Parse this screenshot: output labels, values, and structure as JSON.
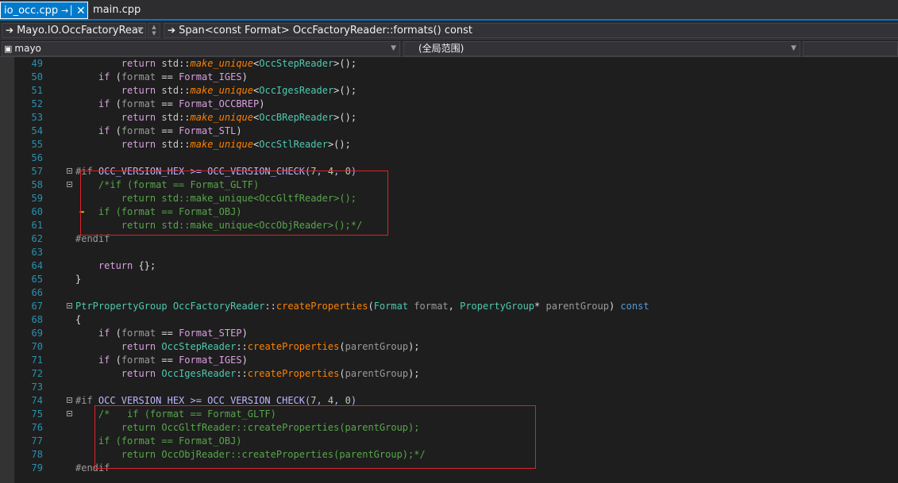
{
  "tabs": [
    {
      "label": "io_occ.cpp",
      "active": true,
      "pin_icon": "pin-icon",
      "close_icon": "close-icon"
    },
    {
      "label": "main.cpp",
      "active": false
    }
  ],
  "navbar": {
    "project_combo": "Mayo.IO.OccFactoryReac",
    "function_combo": "Span<const Format> OccFactoryReader::formats() const"
  },
  "navbar2": {
    "scope_combo": "mayo",
    "global_combo": "(全局范围)"
  },
  "colors": {
    "accent": "#007acc",
    "background": "#1e1e1e",
    "line_number": "#2b91af",
    "highlight_box": "#e0202a"
  },
  "lines": [
    {
      "n": "49",
      "text": "        return std::make_unique<OccStepReader>();"
    },
    {
      "n": "50",
      "text": "    if (format == Format_IGES)"
    },
    {
      "n": "51",
      "text": "        return std::make_unique<OccIgesReader>();"
    },
    {
      "n": "52",
      "text": "    if (format == Format_OCCBREP)"
    },
    {
      "n": "53",
      "text": "        return std::make_unique<OccBRepReader>();"
    },
    {
      "n": "54",
      "text": "    if (format == Format_STL)"
    },
    {
      "n": "55",
      "text": "        return std::make_unique<OccStlReader>();"
    },
    {
      "n": "56",
      "text": ""
    },
    {
      "n": "57",
      "text": "#if OCC_VERSION_HEX >= OCC_VERSION_CHECK(7, 4, 0)"
    },
    {
      "n": "58",
      "text": "    /*if (format == Format_GLTF)"
    },
    {
      "n": "59",
      "text": "        return std::make_unique<OccGltfReader>();"
    },
    {
      "n": "60",
      "text": "    if (format == Format_OBJ)"
    },
    {
      "n": "61",
      "text": "        return std::make_unique<OccObjReader>();*/"
    },
    {
      "n": "62",
      "text": "#endif"
    },
    {
      "n": "63",
      "text": ""
    },
    {
      "n": "64",
      "text": "    return {};"
    },
    {
      "n": "65",
      "text": "}"
    },
    {
      "n": "66",
      "text": ""
    },
    {
      "n": "67",
      "text": "PtrPropertyGroup OccFactoryReader::createProperties(Format format, PropertyGroup* parentGroup) const"
    },
    {
      "n": "68",
      "text": "{"
    },
    {
      "n": "69",
      "text": "    if (format == Format_STEP)"
    },
    {
      "n": "70",
      "text": "        return OccStepReader::createProperties(parentGroup);"
    },
    {
      "n": "71",
      "text": "    if (format == Format_IGES)"
    },
    {
      "n": "72",
      "text": "        return OccIgesReader::createProperties(parentGroup);"
    },
    {
      "n": "73",
      "text": ""
    },
    {
      "n": "74",
      "text": "#if OCC_VERSION_HEX >= OCC_VERSION_CHECK(7, 4, 0)"
    },
    {
      "n": "75",
      "text": "    /*   if (format == Format_GLTF)"
    },
    {
      "n": "76",
      "text": "        return OccGltfReader::createProperties(parentGroup);"
    },
    {
      "n": "77",
      "text": "    if (format == Format_OBJ)"
    },
    {
      "n": "78",
      "text": "        return OccObjReader::createProperties(parentGroup);*/"
    },
    {
      "n": "79",
      "text": "#endif"
    }
  ]
}
